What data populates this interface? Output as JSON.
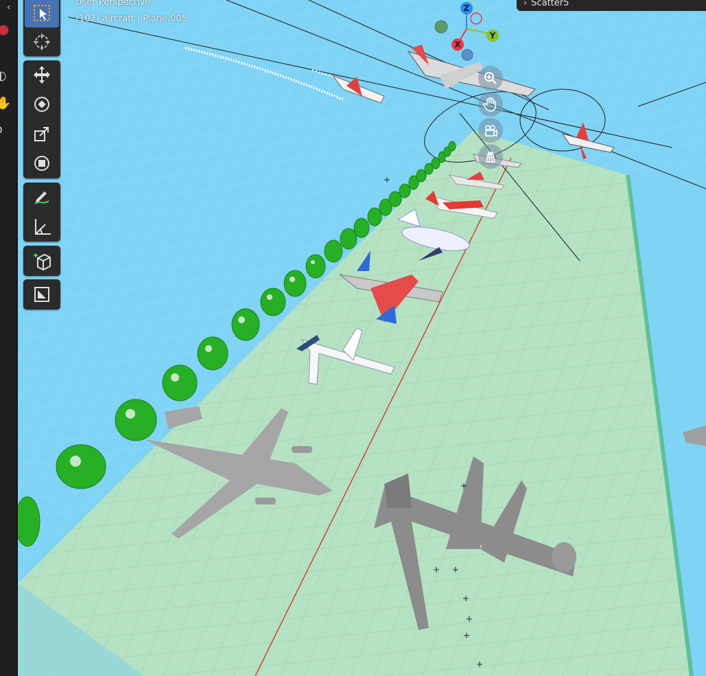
{
  "viewport": {
    "title": "User Perspective",
    "subtitle": "(107) aircraft | Plane.005"
  },
  "outliner": {
    "item_label": "Scatter5"
  },
  "gizmo": {
    "z_label": "Z",
    "y_label": "Y",
    "x_label": "X"
  },
  "toolbar": {
    "tools": [
      "select-box",
      "cursor",
      "move",
      "rotate",
      "scale",
      "transform",
      "annotate",
      "measure",
      "add-cube",
      "mask"
    ],
    "active_tool": "select-box"
  },
  "navigation": {
    "buttons": [
      "zoom",
      "pan",
      "camera",
      "perspective-grid"
    ]
  },
  "colors": {
    "sky": "#7fd3f5",
    "ground_plane": "#b8e3c0",
    "toolbar_bg": "#2b2b2b",
    "active_tool": "#4772b3",
    "axis_x": "#e8384e",
    "axis_y": "#8bc424",
    "axis_z": "#2c8bf0",
    "trees": "#2fb82c",
    "aircraft": "#a8a8a8"
  }
}
